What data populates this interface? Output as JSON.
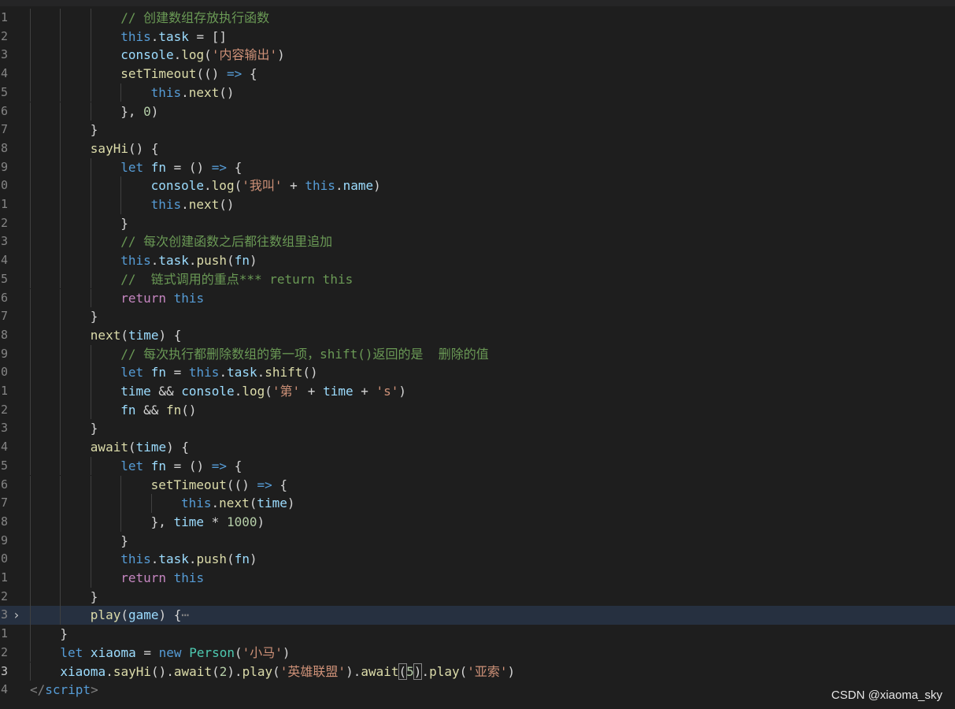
{
  "editor": {
    "lines": [
      {
        "num": "1",
        "indent": 3,
        "tokens": [
          [
            "cm",
            "// 创建数组存放执行函数"
          ]
        ]
      },
      {
        "num": "2",
        "indent": 3,
        "tokens": [
          [
            "st",
            "this"
          ],
          [
            "",
            "."
          ],
          [
            "vr",
            "task"
          ],
          [
            "",
            " = []"
          ]
        ]
      },
      {
        "num": "3",
        "indent": 3,
        "tokens": [
          [
            "vr",
            "console"
          ],
          [
            "",
            "."
          ],
          [
            "fn",
            "log"
          ],
          [
            "",
            "("
          ],
          [
            "str",
            "'内容输出'"
          ],
          [
            "",
            ")"
          ]
        ]
      },
      {
        "num": "4",
        "indent": 3,
        "tokens": [
          [
            "fn",
            "setTimeout"
          ],
          [
            "",
            "(() "
          ],
          [
            "st",
            "=>"
          ],
          [
            "",
            " {"
          ]
        ]
      },
      {
        "num": "5",
        "indent": 4,
        "tokens": [
          [
            "st",
            "this"
          ],
          [
            "",
            "."
          ],
          [
            "fn",
            "next"
          ],
          [
            "",
            "()"
          ]
        ]
      },
      {
        "num": "6",
        "indent": 3,
        "tokens": [
          [
            "",
            "}, "
          ],
          [
            "nm",
            "0"
          ],
          [
            "",
            ")"
          ]
        ]
      },
      {
        "num": "7",
        "indent": 2,
        "tokens": [
          [
            "",
            "}"
          ]
        ]
      },
      {
        "num": "8",
        "indent": 2,
        "tokens": [
          [
            "fn",
            "sayHi"
          ],
          [
            "",
            "() {"
          ]
        ]
      },
      {
        "num": "9",
        "indent": 3,
        "tokens": [
          [
            "st",
            "let"
          ],
          [
            "",
            ""
          ],
          [
            "vr",
            " fn"
          ],
          [
            "",
            " = () "
          ],
          [
            "st",
            "=>"
          ],
          [
            "",
            " {"
          ]
        ]
      },
      {
        "num": "0",
        "indent": 4,
        "tokens": [
          [
            "vr",
            "console"
          ],
          [
            "",
            "."
          ],
          [
            "fn",
            "log"
          ],
          [
            "",
            "("
          ],
          [
            "str",
            "'我叫'"
          ],
          [
            "",
            " + "
          ],
          [
            "st",
            "this"
          ],
          [
            "",
            "."
          ],
          [
            "vr",
            "name"
          ],
          [
            "",
            ")"
          ]
        ]
      },
      {
        "num": "1",
        "indent": 4,
        "tokens": [
          [
            "st",
            "this"
          ],
          [
            "",
            "."
          ],
          [
            "fn",
            "next"
          ],
          [
            "",
            "()"
          ]
        ]
      },
      {
        "num": "2",
        "indent": 3,
        "tokens": [
          [
            "",
            "}"
          ]
        ]
      },
      {
        "num": "3",
        "indent": 3,
        "tokens": [
          [
            "cm",
            "// 每次创建函数之后都往数组里追加"
          ]
        ]
      },
      {
        "num": "4",
        "indent": 3,
        "tokens": [
          [
            "st",
            "this"
          ],
          [
            "",
            "."
          ],
          [
            "vr",
            "task"
          ],
          [
            "",
            "."
          ],
          [
            "fn",
            "push"
          ],
          [
            "",
            "("
          ],
          [
            "vr",
            "fn"
          ],
          [
            "",
            ")"
          ]
        ]
      },
      {
        "num": "5",
        "indent": 3,
        "tokens": [
          [
            "cm",
            "//  链式调用的重点*** return this"
          ]
        ]
      },
      {
        "num": "6",
        "indent": 3,
        "tokens": [
          [
            "kw",
            "return"
          ],
          [
            "",
            " "
          ],
          [
            "st",
            "this"
          ]
        ]
      },
      {
        "num": "7",
        "indent": 2,
        "tokens": [
          [
            "",
            "}"
          ]
        ]
      },
      {
        "num": "8",
        "indent": 2,
        "tokens": [
          [
            "fn",
            "next"
          ],
          [
            "",
            "("
          ],
          [
            "vr",
            "time"
          ],
          [
            "",
            ") {"
          ]
        ]
      },
      {
        "num": "9",
        "indent": 3,
        "tokens": [
          [
            "cm",
            "// 每次执行都删除数组的第一项，shift()返回的是  删除的值"
          ]
        ]
      },
      {
        "num": "0",
        "indent": 3,
        "tokens": [
          [
            "st",
            "let"
          ],
          [
            "vr",
            " fn"
          ],
          [
            "",
            " = "
          ],
          [
            "st",
            "this"
          ],
          [
            "",
            "."
          ],
          [
            "vr",
            "task"
          ],
          [
            "",
            "."
          ],
          [
            "fn",
            "shift"
          ],
          [
            "",
            "()"
          ]
        ]
      },
      {
        "num": "1",
        "indent": 3,
        "tokens": [
          [
            "vr",
            "time"
          ],
          [
            "",
            " && "
          ],
          [
            "vr",
            "console"
          ],
          [
            "",
            "."
          ],
          [
            "fn",
            "log"
          ],
          [
            "",
            "("
          ],
          [
            "str",
            "'第'"
          ],
          [
            "",
            " + "
          ],
          [
            "vr",
            "time"
          ],
          [
            "",
            " + "
          ],
          [
            "str",
            "'s'"
          ],
          [
            "",
            ")"
          ]
        ]
      },
      {
        "num": "2",
        "indent": 3,
        "tokens": [
          [
            "vr",
            "fn"
          ],
          [
            "",
            " && "
          ],
          [
            "fn",
            "fn"
          ],
          [
            "",
            "()"
          ]
        ]
      },
      {
        "num": "3",
        "indent": 2,
        "tokens": [
          [
            "",
            "}"
          ]
        ]
      },
      {
        "num": "4",
        "indent": 2,
        "tokens": [
          [
            "fn",
            "await"
          ],
          [
            "",
            "("
          ],
          [
            "vr",
            "time"
          ],
          [
            "",
            ") {"
          ]
        ]
      },
      {
        "num": "5",
        "indent": 3,
        "tokens": [
          [
            "st",
            "let"
          ],
          [
            "vr",
            " fn"
          ],
          [
            "",
            " = () "
          ],
          [
            "st",
            "=>"
          ],
          [
            "",
            " {"
          ]
        ]
      },
      {
        "num": "6",
        "indent": 4,
        "tokens": [
          [
            "fn",
            "setTimeout"
          ],
          [
            "",
            "(() "
          ],
          [
            "st",
            "=>"
          ],
          [
            "",
            " {"
          ]
        ]
      },
      {
        "num": "7",
        "indent": 5,
        "tokens": [
          [
            "st",
            "this"
          ],
          [
            "",
            "."
          ],
          [
            "fn",
            "next"
          ],
          [
            "",
            "("
          ],
          [
            "vr",
            "time"
          ],
          [
            "",
            ")"
          ]
        ]
      },
      {
        "num": "8",
        "indent": 4,
        "tokens": [
          [
            "",
            "}, "
          ],
          [
            "vr",
            "time"
          ],
          [
            "",
            " * "
          ],
          [
            "nm",
            "1000"
          ],
          [
            "",
            ")"
          ]
        ]
      },
      {
        "num": "9",
        "indent": 3,
        "tokens": [
          [
            "",
            "}"
          ]
        ]
      },
      {
        "num": "0",
        "indent": 3,
        "tokens": [
          [
            "st",
            "this"
          ],
          [
            "",
            "."
          ],
          [
            "vr",
            "task"
          ],
          [
            "",
            "."
          ],
          [
            "fn",
            "push"
          ],
          [
            "",
            "("
          ],
          [
            "vr",
            "fn"
          ],
          [
            "",
            ")"
          ]
        ]
      },
      {
        "num": "1",
        "indent": 3,
        "tokens": [
          [
            "kw",
            "return"
          ],
          [
            "",
            " "
          ],
          [
            "st",
            "this"
          ]
        ]
      },
      {
        "num": "2",
        "indent": 2,
        "tokens": [
          [
            "",
            "}"
          ]
        ]
      },
      {
        "num": "3",
        "indent": 2,
        "active": true,
        "fold": "›",
        "tokens": [
          [
            "fn",
            "play"
          ],
          [
            "",
            "("
          ],
          [
            "vr",
            "game"
          ],
          [
            "",
            ") {"
          ],
          [
            "ellip",
            "⋯"
          ]
        ]
      },
      {
        "num": "1",
        "indent": 1,
        "tokens": [
          [
            "",
            "}"
          ]
        ]
      },
      {
        "num": "2",
        "indent": 1,
        "tokens": [
          [
            "st",
            "let"
          ],
          [
            "vr",
            " xiaoma"
          ],
          [
            "",
            " = "
          ],
          [
            "st",
            "new"
          ],
          [
            "",
            " "
          ],
          [
            "cl",
            "Person"
          ],
          [
            "",
            "("
          ],
          [
            "str",
            "'小马'"
          ],
          [
            "",
            ")"
          ]
        ]
      },
      {
        "num": "3",
        "indent": 1,
        "current": true,
        "tokens": [
          [
            "vr",
            "xiaoma"
          ],
          [
            "",
            "."
          ],
          [
            "fn",
            "sayHi"
          ],
          [
            "",
            "()."
          ],
          [
            "fn",
            "await"
          ],
          [
            "",
            "("
          ],
          [
            "nm",
            "2"
          ],
          [
            "",
            ")."
          ],
          [
            "fn",
            "play"
          ],
          [
            "",
            "("
          ],
          [
            "str",
            "'英雄联盟'"
          ],
          [
            "",
            ")."
          ],
          [
            "fn",
            "await"
          ],
          [
            "pb",
            "("
          ],
          [
            "nm",
            "5"
          ],
          [
            "pb",
            ")"
          ],
          [
            "",
            "."
          ],
          [
            "fn",
            "play"
          ],
          [
            "",
            "("
          ],
          [
            "str",
            "'亚索'"
          ],
          [
            "",
            ")"
          ]
        ]
      },
      {
        "num": "4",
        "indent": 0,
        "tokens": [
          [
            "tagb",
            "</"
          ],
          [
            "tag",
            "script"
          ],
          [
            "tagb",
            ">"
          ]
        ]
      }
    ]
  },
  "watermark": "CSDN @xiaoma_sky"
}
